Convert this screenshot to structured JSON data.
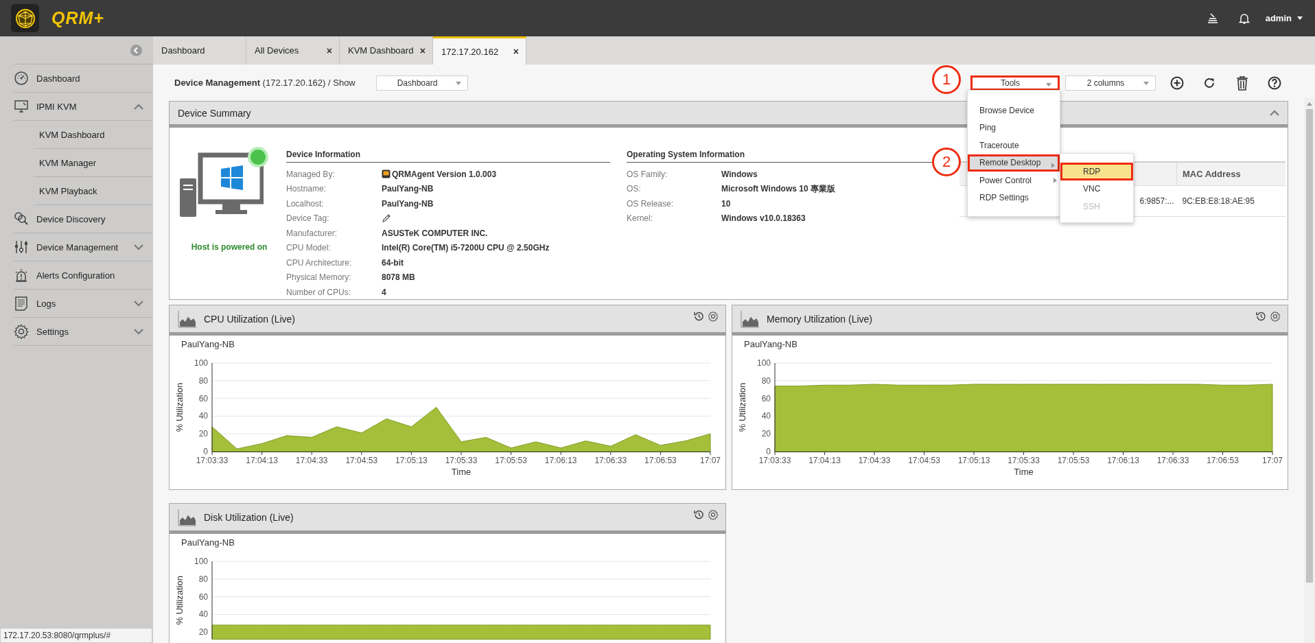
{
  "header": {
    "logo": "QRM+",
    "user": "admin"
  },
  "sidebar": {
    "items": [
      {
        "label": "Dashboard",
        "kind": "link"
      },
      {
        "label": "IPMI KVM",
        "kind": "group",
        "expanded": true,
        "children": [
          {
            "label": "KVM Dashboard"
          },
          {
            "label": "KVM Manager"
          },
          {
            "label": "KVM Playback"
          }
        ]
      },
      {
        "label": "Device Discovery",
        "kind": "link"
      },
      {
        "label": "Device Management",
        "kind": "group",
        "expanded": false
      },
      {
        "label": "Alerts Configuration",
        "kind": "link"
      },
      {
        "label": "Logs",
        "kind": "group",
        "expanded": false
      },
      {
        "label": "Settings",
        "kind": "group",
        "expanded": false
      }
    ]
  },
  "tabs": [
    {
      "label": "Dashboard",
      "selected": false
    },
    {
      "label": "All Devices",
      "selected": false,
      "close": "×"
    },
    {
      "label": "KVM Dashboard",
      "selected": false,
      "close": "×"
    },
    {
      "label": "172.17.20.162",
      "selected": true,
      "close": "×"
    }
  ],
  "toolbar": {
    "title": "Device Management",
    "subtitle": "(172.17.20.162) / Show",
    "view_select": "Dashboard",
    "tools_select": {
      "label": "Tools",
      "annotated": true
    },
    "columns_select": "2 columns"
  },
  "annotations": [
    {
      "label": "1"
    },
    {
      "label": "2"
    }
  ],
  "tools_menu": {
    "items": [
      {
        "label": "Browse Device",
        "selected": false,
        "submenu": false
      },
      {
        "label": "Ping",
        "selected": false,
        "submenu": false
      },
      {
        "label": "Traceroute",
        "selected": false,
        "submenu": false
      },
      {
        "label": "Remote Desktop",
        "selected": true,
        "submenu": true
      },
      {
        "label": "Power Control",
        "selected": false,
        "submenu": true
      },
      {
        "label": "RDP Settings",
        "selected": false,
        "submenu": false
      }
    ],
    "submenu": [
      {
        "label": "RDP",
        "selected": true,
        "disabled": false
      },
      {
        "label": "VNC",
        "selected": false,
        "disabled": false
      },
      {
        "label": "SSH",
        "selected": false,
        "disabled": true
      }
    ]
  },
  "device_summary": {
    "title": "Device Summary",
    "online": true,
    "power_status": "Host is powered on",
    "device_info": {
      "heading": "Device Information",
      "rows": [
        {
          "label": "Managed By:",
          "value": "QRMAgent Version 1.0.003",
          "kind": "agent"
        },
        {
          "label": "Hostname:",
          "value": "PaulYang-NB",
          "kind": "text"
        },
        {
          "label": "Localhost:",
          "value": "PaulYang-NB",
          "kind": "text"
        },
        {
          "label": "Device Tag:",
          "kind": "edit"
        },
        {
          "label": "Manufacturer:",
          "value": "ASUSTeK COMPUTER INC.",
          "kind": "text"
        },
        {
          "label": "CPU Model:",
          "value": "Intel(R) Core(TM) i5-7200U CPU @ 2.50GHz",
          "kind": "text"
        },
        {
          "label": "CPU Architecture:",
          "value": "64-bit",
          "kind": "text"
        },
        {
          "label": "Physical Memory:",
          "value": "8078 MB",
          "kind": "text"
        },
        {
          "label": "Number of CPUs:",
          "value": "4",
          "kind": "text"
        }
      ]
    },
    "os_info": {
      "heading": "Operating System Information",
      "rows": [
        {
          "label": "OS Family:",
          "value": "Windows",
          "kind": "text"
        },
        {
          "label": "OS:",
          "value": "Microsoft Windows 10 專業版",
          "kind": "text"
        },
        {
          "label": "OS Release:",
          "value": "10",
          "kind": "text"
        },
        {
          "label": "Kernel:",
          "value": "Windows v10.0.18363",
          "kind": "text"
        }
      ]
    },
    "network_table": {
      "columns": [
        "",
        "MAC Address"
      ],
      "rows": [
        [
          "6:9857:...",
          "9C:EB:E8:18:AE:95"
        ]
      ]
    }
  },
  "charts": [
    {
      "title": "CPU Utilization (Live)",
      "chart_data": {
        "type": "area",
        "grid": true,
        "xlabel": "Time",
        "ylabel": "% Utilization",
        "categories": [
          "17:03:33",
          null,
          "17:04:13",
          null,
          "17:04:33",
          null,
          "17:04:53",
          null,
          "17:05:13",
          null,
          "17:05:33",
          null,
          "17:05:53",
          null,
          "17:06:13",
          null,
          "17:06:33",
          null,
          "17:06:53",
          null,
          "17:07"
        ],
        "ylim": [
          0,
          100
        ],
        "yticks": [
          0,
          20,
          40,
          60,
          80,
          100
        ],
        "series": [
          {
            "name": "PaulYang-NB",
            "color": "#a5bf3a",
            "values": [
              28,
              3,
              9,
              18,
              16,
              28,
              21,
              37,
              28,
              50,
              11,
              16,
              4,
              11,
              4,
              12,
              6,
              19,
              7,
              12,
              20
            ]
          }
        ]
      }
    },
    {
      "title": "Memory Utilization (Live)",
      "chart_data": {
        "type": "area",
        "grid": true,
        "xlabel": "Time",
        "ylabel": "% Utilization",
        "categories": [
          "17:03:33",
          null,
          "17:04:13",
          null,
          "17:04:33",
          null,
          "17:04:53",
          null,
          "17:05:13",
          null,
          "17:05:33",
          null,
          "17:05:53",
          null,
          "17:06:13",
          null,
          "17:06:33",
          null,
          "17:06:53",
          null,
          "17:07"
        ],
        "ylim": [
          0,
          100
        ],
        "yticks": [
          0,
          20,
          40,
          60,
          80,
          100
        ],
        "series": [
          {
            "name": "PaulYang-NB",
            "color": "#a5bf3a",
            "values": [
              74,
              74,
              75,
              75,
              76,
              75,
              75,
              75,
              76,
              76,
              76,
              76,
              76,
              76,
              76,
              76,
              76,
              76,
              75,
              75,
              76
            ]
          }
        ]
      }
    },
    {
      "title": "Disk Utilization (Live)",
      "chart_data": {
        "type": "area",
        "grid": true,
        "ylabel": "% Utilization",
        "ylim": [
          12,
          100
        ],
        "yticks": [
          20,
          40,
          60,
          80,
          100
        ],
        "series": [
          {
            "name": "PaulYang-NB",
            "color": "#a5bf3a",
            "values": [
              28,
              28,
              28,
              28,
              28,
              28,
              28,
              28,
              28,
              28,
              28,
              28,
              28,
              28,
              28,
              28,
              28,
              28,
              28,
              28,
              28
            ]
          }
        ]
      }
    }
  ],
  "status_url": "172.17.20.53:8080/qrmplus/#"
}
